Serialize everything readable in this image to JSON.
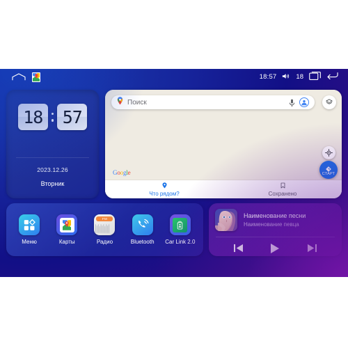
{
  "statusbar": {
    "home_icon": "home-icon",
    "maps_badge_icon": "google-maps-icon",
    "time": "18:57",
    "volume_icon": "volume-icon",
    "volume_level": "18",
    "recents_icon": "recent-apps-icon",
    "back_icon": "back-arrow-icon"
  },
  "clock": {
    "hours": "18",
    "minutes": "57",
    "date": "2023.12.26",
    "weekday": "Вторник"
  },
  "map": {
    "search_placeholder": "Поиск",
    "mic_icon": "microphone-icon",
    "avatar_icon": "account-avatar-icon",
    "layers_icon": "map-layers-icon",
    "compass_icon": "compass-icon",
    "start_label": "СТАРТ",
    "attribution": "Google",
    "tabs": [
      {
        "label": "Что рядом?",
        "icon": "map-pin-icon",
        "active": true
      },
      {
        "label": "Сохранено",
        "icon": "bookmark-icon",
        "active": false
      }
    ]
  },
  "apps": [
    {
      "label": "Меню",
      "icon": "app-grid-icon"
    },
    {
      "label": "Карты",
      "icon": "google-maps-icon"
    },
    {
      "label": "Радио",
      "icon": "radio-icon",
      "band": "FM"
    },
    {
      "label": "Bluetooth",
      "icon": "bluetooth-phone-icon"
    },
    {
      "label": "Car Link 2.0",
      "icon": "car-link-icon"
    }
  ],
  "music": {
    "album_art": "album-cover-portrait",
    "title": "Наименование песни",
    "artist": "Наименование певца",
    "prev_icon": "previous-track-icon",
    "play_icon": "play-icon",
    "next_icon": "next-track-icon"
  },
  "colors": {
    "bg_blue": "#16249b",
    "bg_purple": "#4d138f",
    "map_bg": "#efebe2",
    "accent_blue": "#1a73e8",
    "music_purple": "#6c1eb0"
  }
}
